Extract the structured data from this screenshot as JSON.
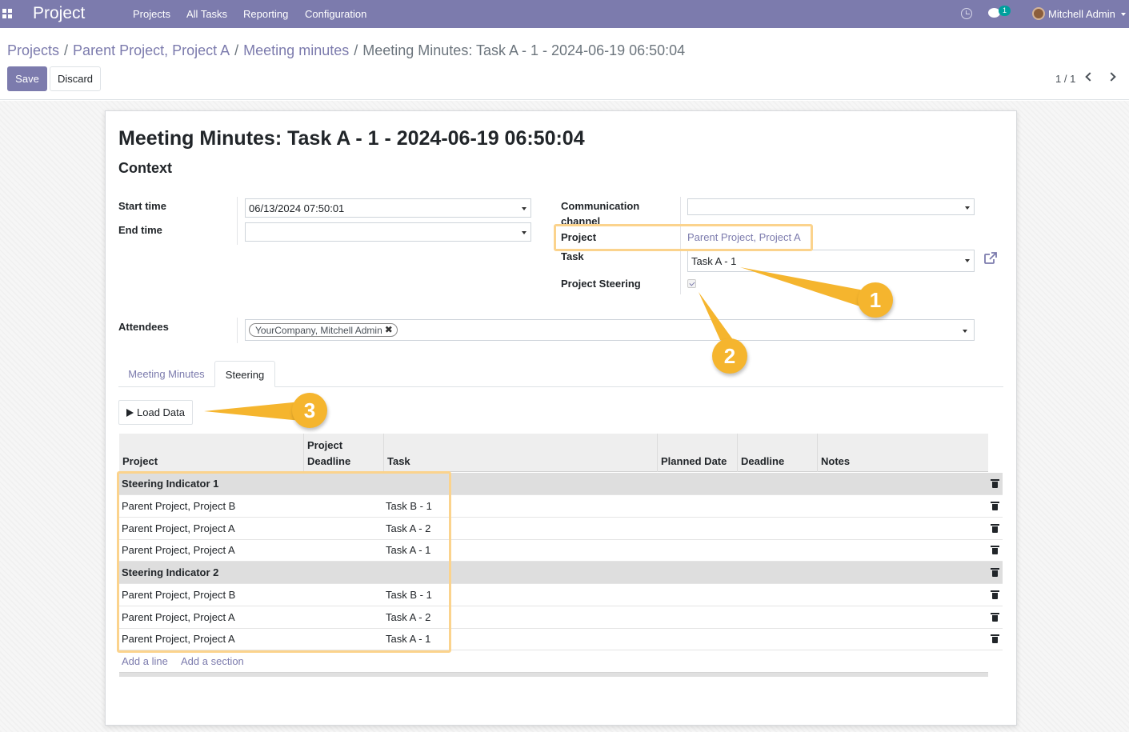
{
  "navbar": {
    "brand": "Project",
    "menu": [
      "Projects",
      "All Tasks",
      "Reporting",
      "Configuration"
    ],
    "chat_count": "1",
    "user": "Mitchell Admin"
  },
  "breadcrumb": {
    "items": [
      "Projects",
      "Parent Project, Project A",
      "Meeting minutes"
    ],
    "current": "Meeting Minutes: Task A - 1 - 2024-06-19 06:50:04"
  },
  "actions": {
    "save": "Save",
    "discard": "Discard"
  },
  "pager": "1 / 1",
  "record": {
    "title": "Meeting Minutes: Task A - 1 - 2024-06-19 06:50:04",
    "section": "Context"
  },
  "fields": {
    "start_time": {
      "label": "Start time",
      "value": "06/13/2024 07:50:01"
    },
    "end_time": {
      "label": "End time",
      "value": ""
    },
    "channel": {
      "label_1": "Communication",
      "label_2": "channel",
      "value": ""
    },
    "project": {
      "label": "Project",
      "value": "Parent Project, Project A"
    },
    "task": {
      "label": "Task",
      "value": "Task A - 1"
    },
    "steering": {
      "label": "Project Steering",
      "checked": true
    },
    "attendees": {
      "label": "Attendees",
      "tags": [
        "YourCompany, Mitchell Admin"
      ]
    }
  },
  "tabs": [
    "Meeting Minutes",
    "Steering"
  ],
  "load_button": "Load Data",
  "table": {
    "headers": {
      "project": "Project",
      "deadline_1": "Project",
      "deadline_2": "Deadline",
      "task": "Task",
      "planned": "Planned Date",
      "deadline": "Deadline",
      "notes": "Notes"
    },
    "rows": [
      {
        "type": "section",
        "project": "Steering Indicator 1",
        "task": ""
      },
      {
        "type": "line",
        "project": "Parent Project, Project B",
        "task": "Task B - 1"
      },
      {
        "type": "line",
        "project": "Parent Project, Project A",
        "task": "Task A - 2"
      },
      {
        "type": "line",
        "project": "Parent Project, Project A",
        "task": "Task A - 1"
      },
      {
        "type": "section",
        "project": "Steering Indicator 2",
        "task": ""
      },
      {
        "type": "line",
        "project": "Parent Project, Project B",
        "task": "Task B - 1"
      },
      {
        "type": "line",
        "project": "Parent Project, Project A",
        "task": "Task A - 2"
      },
      {
        "type": "line",
        "project": "Parent Project, Project A",
        "task": "Task A - 1"
      }
    ],
    "add_line": "Add a line",
    "add_section": "Add a section"
  },
  "annotations": [
    "1",
    "2",
    "3"
  ],
  "colors": {
    "brand": "#7c7bad",
    "callout": "#f5b52e",
    "highlight": "#fbd38d"
  }
}
